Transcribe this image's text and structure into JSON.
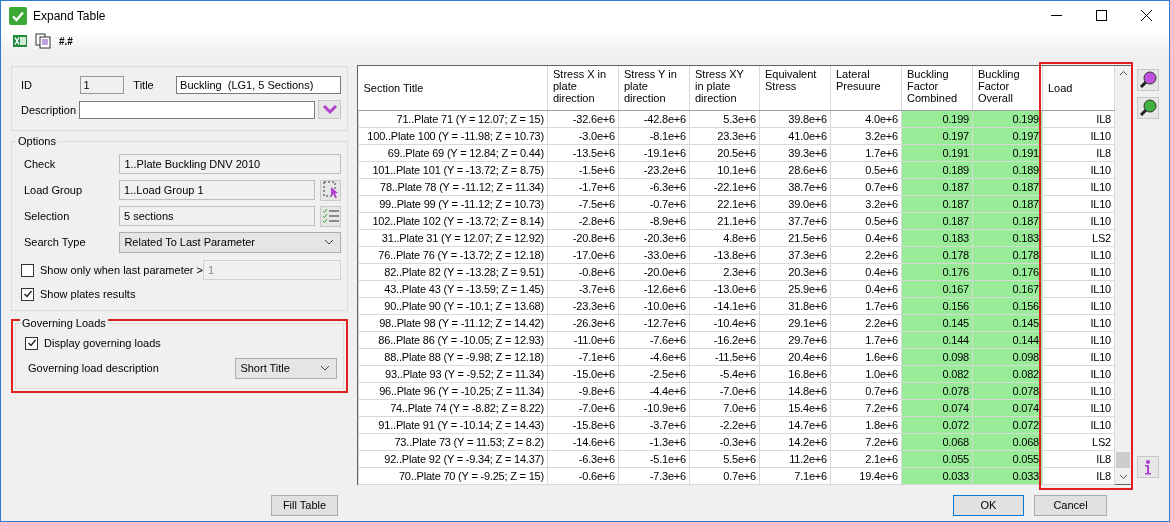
{
  "window": {
    "title": "Expand Table"
  },
  "toolbar": {
    "number_format": "#.#"
  },
  "general": {
    "id_label": "ID",
    "id_value": "1",
    "title_label": "Title",
    "title_value": "Buckling  (LG1, 5 Sections)",
    "description_label": "Description"
  },
  "options": {
    "title": "Options",
    "fields": [
      {
        "kind": "text",
        "label": "Check",
        "value": "1..Plate Buckling DNV 2010"
      },
      {
        "kind": "pick",
        "label": "Load Group",
        "value": "1..Load Group 1"
      },
      {
        "kind": "list",
        "label": "Selection",
        "value": "5 sections"
      },
      {
        "kind": "combo",
        "label": "Search Type",
        "value": "Related To Last Parameter"
      }
    ],
    "checks": [
      {
        "label": "Show only when last parameter >",
        "checked": false,
        "value": "1",
        "disabled": true
      },
      {
        "label": "Show plates results",
        "checked": true
      }
    ]
  },
  "governing_loads": {
    "title": "Governing Loads",
    "framed": true,
    "display": {
      "label": "Display governing loads",
      "checked": true
    },
    "description": {
      "label": "Governing load description",
      "value": "Short Title"
    }
  },
  "table": {
    "columns": [
      {
        "title": "Section Title",
        "highlighted": false,
        "framed": false
      },
      {
        "title": "Stress X in plate direction",
        "highlighted": false,
        "framed": false
      },
      {
        "title": "Stress Y in plate direction",
        "highlighted": false,
        "framed": false
      },
      {
        "title": "Stress XY in plate direction",
        "highlighted": false,
        "framed": false
      },
      {
        "title": "Equivalent Stress",
        "highlighted": false,
        "framed": false
      },
      {
        "title": "Lateral Presuure",
        "highlighted": false,
        "framed": false
      },
      {
        "title": "Buckling Factor Combined",
        "highlighted": true,
        "framed": false
      },
      {
        "title": "Buckling Factor Overall",
        "highlighted": true,
        "framed": false
      },
      {
        "title": "Load",
        "highlighted": false,
        "framed": true
      }
    ],
    "rows": [
      [
        "71..Plate 71 (Y = 12.07; Z = 15)",
        "-32.6e+6",
        "-42.8e+6",
        "5.3e+6",
        "39.8e+6",
        "4.0e+6",
        "0.199",
        "0.199",
        "IL8"
      ],
      [
        "100..Plate 100 (Y = -11.98; Z = 10.73)",
        "-3.0e+6",
        "-8.1e+6",
        "23.3e+6",
        "41.0e+6",
        "3.2e+6",
        "0.197",
        "0.197",
        "IL10"
      ],
      [
        "69..Plate 69 (Y = 12.84; Z = 0.44)",
        "-13.5e+6",
        "-19.1e+6",
        "20.5e+6",
        "39.3e+6",
        "1.7e+6",
        "0.191",
        "0.191",
        "IL8"
      ],
      [
        "101..Plate 101 (Y = -13.72; Z = 8.75)",
        "-1.5e+6",
        "-23.2e+6",
        "10.1e+6",
        "28.6e+6",
        "0.5e+6",
        "0.189",
        "0.189",
        "IL10"
      ],
      [
        "78..Plate 78 (Y = -11.12; Z = 11.34)",
        "-1.7e+6",
        "-6.3e+6",
        "-22.1e+6",
        "38.7e+6",
        "0.7e+6",
        "0.187",
        "0.187",
        "IL10"
      ],
      [
        "99..Plate 99 (Y = -11.12; Z = 10.73)",
        "-7.5e+6",
        "-0.7e+6",
        "22.1e+6",
        "39.0e+6",
        "3.2e+6",
        "0.187",
        "0.187",
        "IL10"
      ],
      [
        "102..Plate 102 (Y = -13.72; Z = 8.14)",
        "-2.8e+6",
        "-8.9e+6",
        "21.1e+6",
        "37.7e+6",
        "0.5e+6",
        "0.187",
        "0.187",
        "IL10"
      ],
      [
        "31..Plate 31 (Y = 12.07; Z = 12.92)",
        "-20.8e+6",
        "-20.3e+6",
        "4.8e+6",
        "21.5e+6",
        "0.4e+6",
        "0.183",
        "0.183",
        "LS2"
      ],
      [
        "76..Plate 76 (Y = -13.72; Z = 12.18)",
        "-17.0e+6",
        "-33.0e+6",
        "-13.8e+6",
        "37.3e+6",
        "2.2e+6",
        "0.178",
        "0.178",
        "IL10"
      ],
      [
        "82..Plate 82 (Y = -13.28; Z = 9.51)",
        "-0.8e+6",
        "-20.0e+6",
        "2.3e+6",
        "20.3e+6",
        "0.4e+6",
        "0.176",
        "0.176",
        "IL10"
      ],
      [
        "43..Plate 43 (Y = -13.59; Z = 1.45)",
        "-3.7e+6",
        "-12.6e+6",
        "-13.0e+6",
        "25.9e+6",
        "0.4e+6",
        "0.167",
        "0.167",
        "IL10"
      ],
      [
        "90..Plate 90 (Y = -10.1; Z = 13.68)",
        "-23.3e+6",
        "-10.0e+6",
        "-14.1e+6",
        "31.8e+6",
        "1.7e+6",
        "0.156",
        "0.156",
        "IL10"
      ],
      [
        "98..Plate 98 (Y = -11.12; Z = 14.42)",
        "-26.3e+6",
        "-12.7e+6",
        "-10.4e+6",
        "29.1e+6",
        "2.2e+6",
        "0.145",
        "0.145",
        "IL10"
      ],
      [
        "86..Plate 86 (Y = -10.05; Z = 12.93)",
        "-11.0e+6",
        "-7.6e+6",
        "-16.2e+6",
        "29.7e+6",
        "1.7e+6",
        "0.144",
        "0.144",
        "IL10"
      ],
      [
        "88..Plate 88 (Y = -9.98; Z = 12.18)",
        "-7.1e+6",
        "-4.6e+6",
        "-11.5e+6",
        "20.4e+6",
        "1.6e+6",
        "0.098",
        "0.098",
        "IL10"
      ],
      [
        "93..Plate 93 (Y = -9.52; Z = 11.34)",
        "-15.0e+6",
        "-2.5e+6",
        "-5.4e+6",
        "16.8e+6",
        "1.0e+6",
        "0.082",
        "0.082",
        "IL10"
      ],
      [
        "96..Plate 96 (Y = -10.25; Z = 11.34)",
        "-9.8e+6",
        "-4.4e+6",
        "-7.0e+6",
        "14.8e+6",
        "0.7e+6",
        "0.078",
        "0.078",
        "IL10"
      ],
      [
        "74..Plate 74 (Y = -8.82; Z = 8.22)",
        "-7.0e+6",
        "-10.9e+6",
        "7.0e+6",
        "15.4e+6",
        "7.2e+6",
        "0.074",
        "0.074",
        "IL10"
      ],
      [
        "91..Plate 91 (Y = -10.14; Z = 14.43)",
        "-15.8e+6",
        "-3.7e+6",
        "-2.2e+6",
        "14.7e+6",
        "1.8e+6",
        "0.072",
        "0.072",
        "IL10"
      ],
      [
        "73..Plate 73 (Y = 11.53; Z = 8.2)",
        "-14.6e+6",
        "-1.3e+6",
        "-0.3e+6",
        "14.2e+6",
        "7.2e+6",
        "0.068",
        "0.068",
        "LS2"
      ],
      [
        "92..Plate 92 (Y = -9.34; Z = 14.37)",
        "-6.3e+6",
        "-5.1e+6",
        "5.5e+6",
        "11.2e+6",
        "2.1e+6",
        "0.055",
        "0.055",
        "IL8"
      ],
      [
        "70..Plate 70 (Y = -9.25; Z = 15)",
        "-0.6e+6",
        "-7.3e+6",
        "0.7e+6",
        "7.1e+6",
        "19.4e+6",
        "0.033",
        "0.033",
        "IL8"
      ]
    ]
  },
  "buttons": {
    "fill": "Fill Table",
    "ok": "OK",
    "cancel": "Cancel"
  }
}
